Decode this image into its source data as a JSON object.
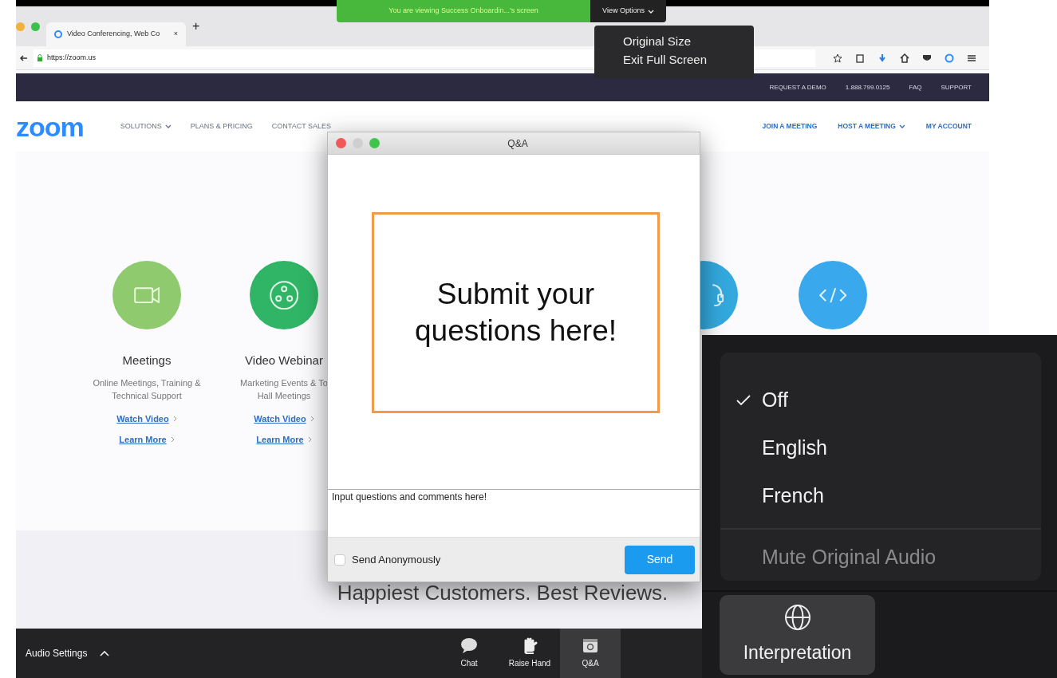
{
  "share_banner": {
    "text": "You are viewing Success Onboardin...'s screen",
    "view_options": "View Options"
  },
  "view_options_menu": [
    "Original Size",
    "Exit Full Screen"
  ],
  "browser": {
    "tab_title": "Video Conferencing, Web Co",
    "tab_close": "×",
    "new_tab": "+",
    "url": "https://zoom.us"
  },
  "site": {
    "top_links": [
      "REQUEST A DEMO",
      "1.888.799.0125",
      "FAQ",
      "SUPPORT"
    ],
    "logo": "zoom",
    "nav_left": [
      {
        "label": "SOLUTIONS",
        "dropdown": true
      },
      {
        "label": "PLANS & PRICING",
        "dropdown": false
      },
      {
        "label": "CONTACT SALES",
        "dropdown": false
      }
    ],
    "nav_right": [
      {
        "label": "JOIN A MEETING",
        "dropdown": false
      },
      {
        "label": "HOST A MEETING",
        "dropdown": true
      },
      {
        "label": "MY ACCOUNT",
        "dropdown": false
      }
    ],
    "products": [
      {
        "kind": "video",
        "color": "#8fcb6e",
        "title": "Meetings",
        "description": [
          "Online Meetings, Training &",
          "Technical Support"
        ],
        "links": [
          "Watch Video",
          "Learn More"
        ]
      },
      {
        "kind": "webinar",
        "color": "#2fb565",
        "title": "Video Webinar",
        "description": [
          "Marketing Events & To",
          "Hall Meetings"
        ],
        "links": [
          "Watch Video",
          "Learn More"
        ]
      },
      {
        "kind": "headset",
        "color": "#33a9de"
      },
      {
        "kind": "code",
        "color": "#3aa8ec"
      }
    ],
    "tagline": "Happiest Customers. Best Reviews."
  },
  "meeting_toolbar": {
    "audio_settings": "Audio Settings",
    "buttons": [
      {
        "kind": "chat",
        "label": "Chat",
        "selected": false
      },
      {
        "kind": "hand",
        "label": "Raise Hand",
        "selected": false
      },
      {
        "kind": "qa",
        "label": "Q&A",
        "selected": true
      }
    ]
  },
  "qa_window": {
    "title": "Q&A",
    "callout": "Submit your questions here!",
    "input_placeholder": "Input questions and comments here!",
    "anonymous": {
      "label": "Send Anonymously",
      "checked": false
    },
    "send": "Send"
  },
  "interpretation": {
    "options": [
      {
        "label": "Off",
        "selected": true
      },
      {
        "label": "English",
        "selected": false
      },
      {
        "label": "French",
        "selected": false
      }
    ],
    "mute_original": {
      "label": "Mute Original Audio",
      "disabled": true
    },
    "button": "Interpretation"
  }
}
